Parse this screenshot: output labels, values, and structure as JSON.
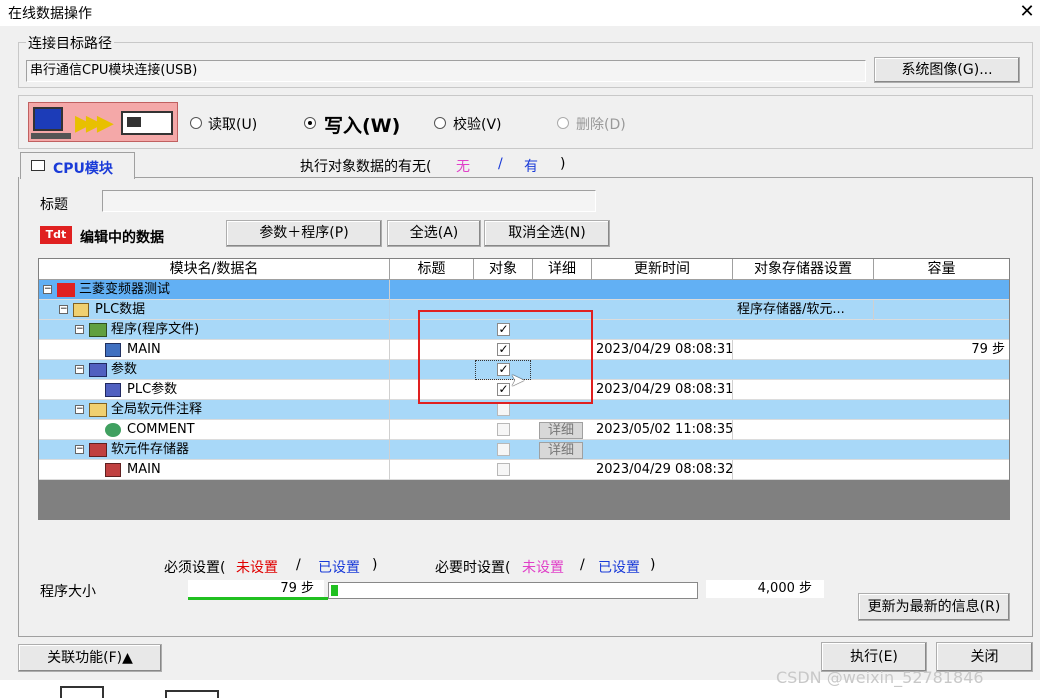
{
  "window": {
    "title": "在线数据操作"
  },
  "connection": {
    "legend": "连接目标路径",
    "path": "串行通信CPU模块连接(USB)",
    "system_image_button": "系统图像(G)..."
  },
  "operations": {
    "read": "读取(U)",
    "write": "写入(W)",
    "verify": "校验(V)",
    "delete": "删除(D)"
  },
  "tab": {
    "label": "CPU模块"
  },
  "target_data": {
    "label": "执行对象数据的有无(",
    "none": "无",
    "sep": "/",
    "has": "有",
    "close": ")"
  },
  "title_field": {
    "label": "标题",
    "value": ""
  },
  "editing": {
    "label": "编辑中的数据",
    "params_program_button": "参数＋程序(P)",
    "select_all_button": "全选(A)",
    "deselect_all_button": "取消全选(N)"
  },
  "table": {
    "headers": [
      "模块名/数据名",
      "标题",
      "对象",
      "详细",
      "更新时间",
      "对象存储器设置",
      "容量"
    ],
    "rows": [
      {
        "name": "三菱变频器测试",
        "update": "",
        "memory": "",
        "capacity": ""
      },
      {
        "name": "PLC数据",
        "update": "",
        "memory": "程序存储器/软元...",
        "capacity": ""
      },
      {
        "name": "程序(程序文件)",
        "update": "",
        "memory": "",
        "capacity": ""
      },
      {
        "name": "MAIN",
        "update": "2023/04/29 08:08:31",
        "memory": "",
        "capacity": "79 步"
      },
      {
        "name": "参数",
        "update": "",
        "memory": "",
        "capacity": ""
      },
      {
        "name": "PLC参数",
        "update": "2023/04/29 08:08:31",
        "memory": "",
        "capacity": ""
      },
      {
        "name": "全局软元件注释",
        "update": "",
        "memory": "",
        "capacity": ""
      },
      {
        "name": "COMMENT",
        "update": "2023/05/02 11:08:35",
        "memory": "",
        "capacity": ""
      },
      {
        "name": "软元件存储器",
        "update": "",
        "memory": "",
        "capacity": ""
      },
      {
        "name": "MAIN",
        "update": "2023/04/29 08:08:32",
        "memory": "",
        "capacity": ""
      }
    ],
    "detail_label": "详细"
  },
  "settings": {
    "required": "必须设置(",
    "unset": "未设置",
    "sep": "/",
    "set": "已设置",
    "close": ")",
    "optional": "必要时设置("
  },
  "program_size": {
    "label": "程序大小",
    "used": "79 步",
    "total": "4,000 步",
    "used_fraction": 0.02
  },
  "buttons": {
    "refresh": "更新为最新的信息(R)",
    "related": "关联功能(F)▲",
    "execute": "执行(E)",
    "close": "关闭"
  },
  "colors": {
    "row_blue": "#a8d8f8",
    "row_selected": "#62b0f4",
    "accent_red": "#e00000",
    "accent_blue": "#1a3bd8",
    "accent_pink": "#e040c8"
  },
  "watermark": "CSDN @weixin_52781846"
}
